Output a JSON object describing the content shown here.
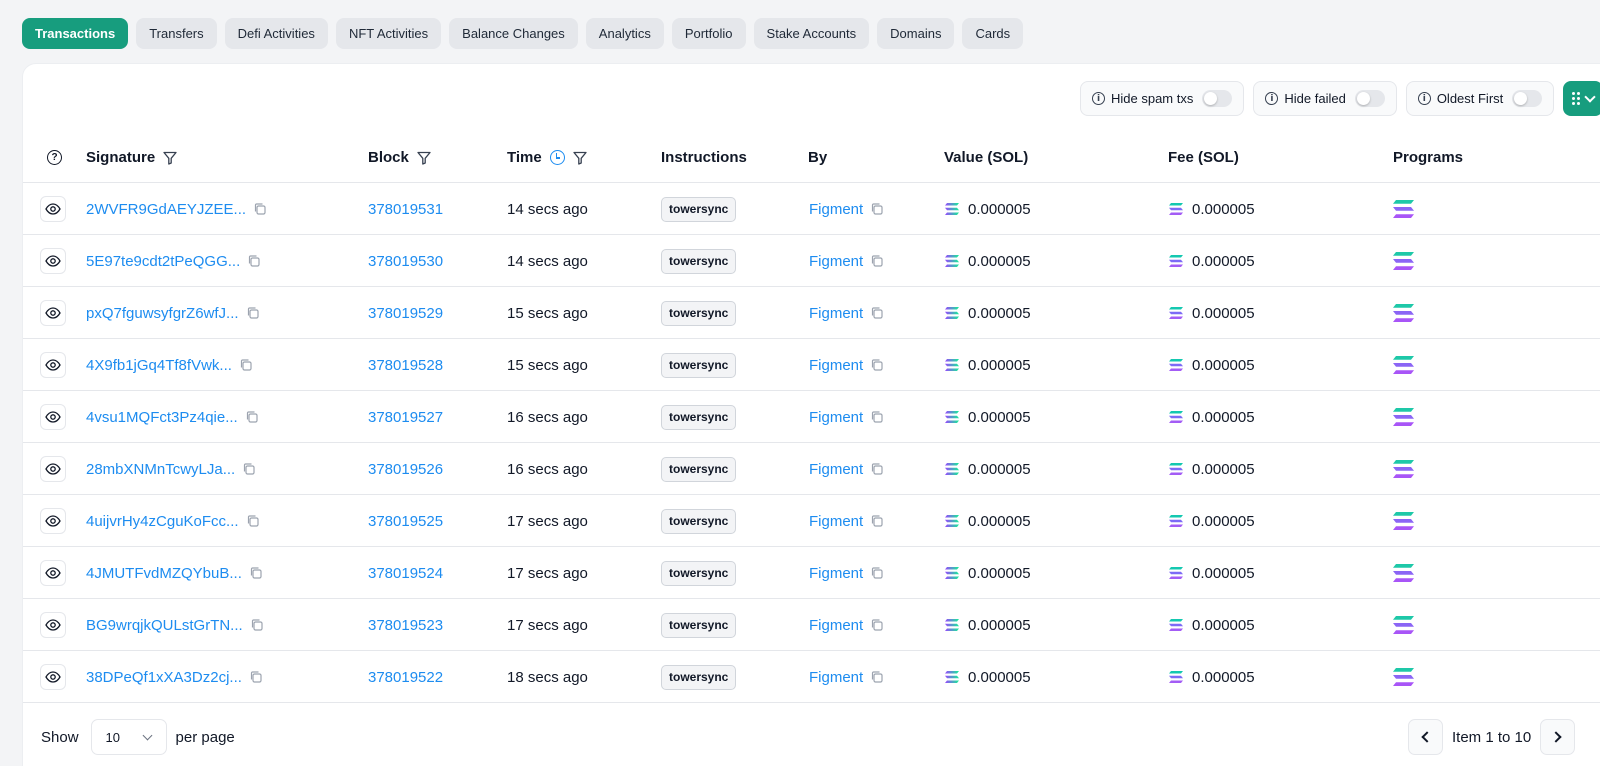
{
  "tabs": [
    {
      "label": "Transactions",
      "active": true
    },
    {
      "label": "Transfers"
    },
    {
      "label": "Defi Activities"
    },
    {
      "label": "NFT Activities"
    },
    {
      "label": "Balance Changes"
    },
    {
      "label": "Analytics"
    },
    {
      "label": "Portfolio"
    },
    {
      "label": "Stake Accounts"
    },
    {
      "label": "Domains"
    },
    {
      "label": "Cards"
    }
  ],
  "toolbar": {
    "hide_spam": "Hide spam txs",
    "hide_failed": "Hide failed",
    "oldest_first": "Oldest First"
  },
  "columns": {
    "signature": "Signature",
    "block": "Block",
    "time": "Time",
    "instructions": "Instructions",
    "by": "By",
    "value": "Value (SOL)",
    "fee": "Fee (SOL)",
    "programs": "Programs"
  },
  "rows": [
    {
      "signature": "2WVFR9GdAEYJZEE...",
      "block": "378019531",
      "time": "14 secs ago",
      "instruction": "towersync",
      "by": "Figment",
      "value": "0.000005",
      "fee": "0.000005"
    },
    {
      "signature": "5E97te9cdt2tPeQGG...",
      "block": "378019530",
      "time": "14 secs ago",
      "instruction": "towersync",
      "by": "Figment",
      "value": "0.000005",
      "fee": "0.000005"
    },
    {
      "signature": "pxQ7fguwsyfgrZ6wfJ...",
      "block": "378019529",
      "time": "15 secs ago",
      "instruction": "towersync",
      "by": "Figment",
      "value": "0.000005",
      "fee": "0.000005"
    },
    {
      "signature": "4X9fb1jGq4Tf8fVwk...",
      "block": "378019528",
      "time": "15 secs ago",
      "instruction": "towersync",
      "by": "Figment",
      "value": "0.000005",
      "fee": "0.000005"
    },
    {
      "signature": "4vsu1MQFct3Pz4qie...",
      "block": "378019527",
      "time": "16 secs ago",
      "instruction": "towersync",
      "by": "Figment",
      "value": "0.000005",
      "fee": "0.000005"
    },
    {
      "signature": "28mbXNMnTcwyLJa...",
      "block": "378019526",
      "time": "16 secs ago",
      "instruction": "towersync",
      "by": "Figment",
      "value": "0.000005",
      "fee": "0.000005"
    },
    {
      "signature": "4uijvrHy4zCguKoFcc...",
      "block": "378019525",
      "time": "17 secs ago",
      "instruction": "towersync",
      "by": "Figment",
      "value": "0.000005",
      "fee": "0.000005"
    },
    {
      "signature": "4JMUTFvdMZQYbuB...",
      "block": "378019524",
      "time": "17 secs ago",
      "instruction": "towersync",
      "by": "Figment",
      "value": "0.000005",
      "fee": "0.000005"
    },
    {
      "signature": "BG9wrqjkQULstGrTN...",
      "block": "378019523",
      "time": "17 secs ago",
      "instruction": "towersync",
      "by": "Figment",
      "value": "0.000005",
      "fee": "0.000005"
    },
    {
      "signature": "38DPeQf1xXA3Dz2cj...",
      "block": "378019522",
      "time": "18 secs ago",
      "instruction": "towersync",
      "by": "Figment",
      "value": "0.000005",
      "fee": "0.000005"
    }
  ],
  "footer": {
    "show": "Show",
    "per_page_value": "10",
    "per_page": "per page",
    "item_range": "Item 1 to 10"
  },
  "colors": {
    "accent": "#179d7e",
    "link": "#1d8cf0"
  }
}
